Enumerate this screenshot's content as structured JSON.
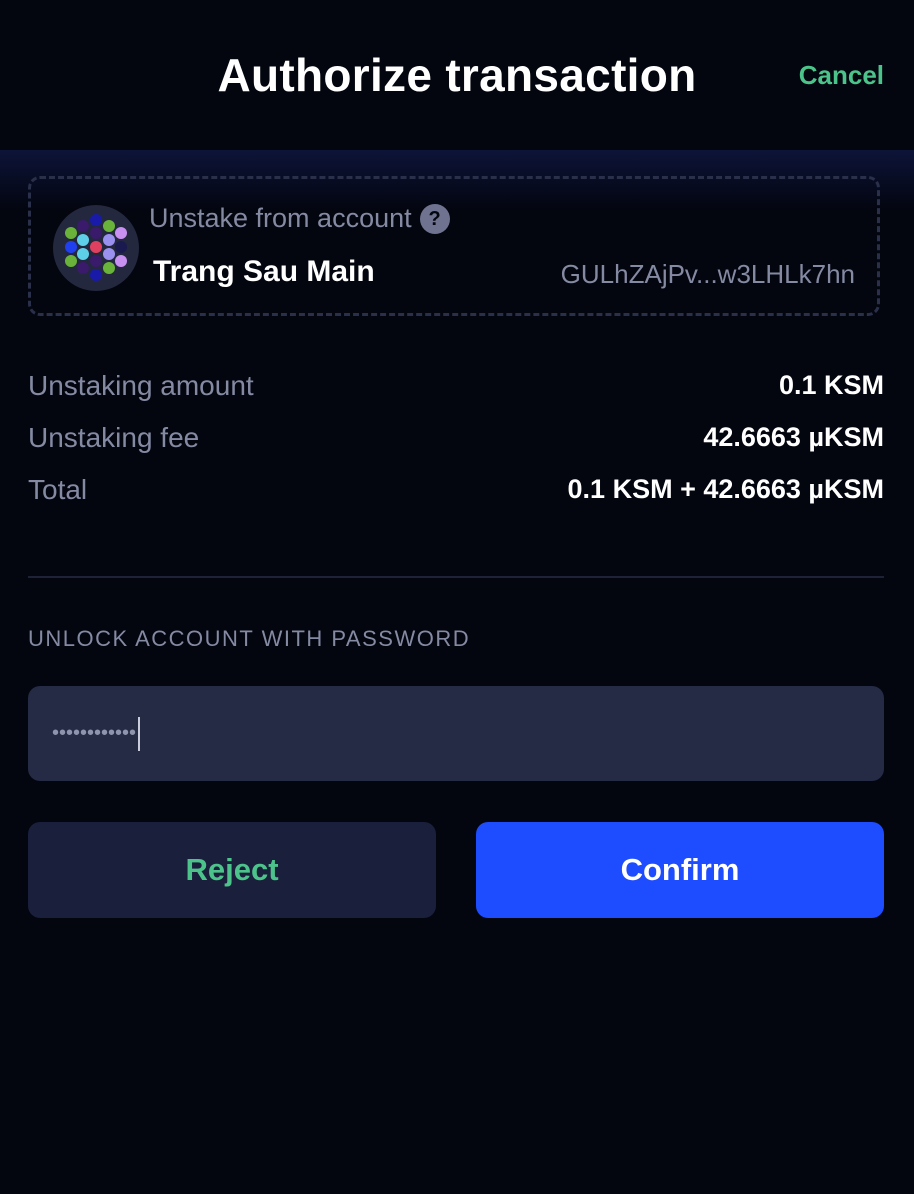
{
  "header": {
    "title": "Authorize transaction",
    "cancel_label": "Cancel"
  },
  "account": {
    "label": "Unstake from account",
    "help_icon": "?",
    "name": "Trang Sau Main",
    "address": "GULhZAjPv...w3LHLk7hn",
    "avatar_icon": "identicon"
  },
  "details": [
    {
      "label": "Unstaking amount",
      "value": "0.1 KSM"
    },
    {
      "label": "Unstaking fee",
      "value": "42.6663 µKSM"
    },
    {
      "label": "Total",
      "value": "0.1 KSM + 42.6663 µKSM"
    }
  ],
  "password": {
    "label": "UNLOCK ACCOUNT WITH PASSWORD",
    "masked_value": "••••••••••••"
  },
  "actions": {
    "reject_label": "Reject",
    "confirm_label": "Confirm"
  },
  "colors": {
    "background": "#03050f",
    "accent_green": "#4cc38a",
    "confirm_blue": "#1e4cff",
    "muted_text": "#858aa3"
  }
}
